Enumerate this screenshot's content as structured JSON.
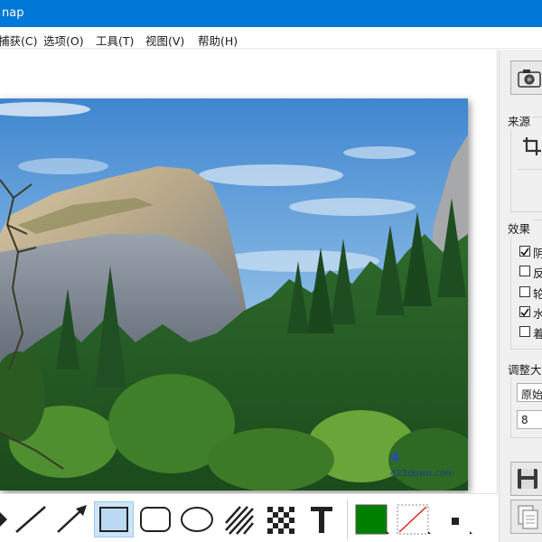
{
  "window": {
    "title": "nap"
  },
  "menu": [
    {
      "label": "捕获(C)"
    },
    {
      "label": "选项(O)"
    },
    {
      "label": "工具(T)"
    },
    {
      "label": "视图(V)"
    },
    {
      "label": "帮助(H)"
    }
  ],
  "canvas": {
    "watermark_brand": "4",
    "watermark_url": "423down.com"
  },
  "toolbar": {
    "tools": [
      {
        "icon": "arrow-head-icon"
      },
      {
        "icon": "line-icon"
      },
      {
        "icon": "arrow-icon"
      },
      {
        "icon": "rectangle-icon",
        "active": true
      },
      {
        "icon": "rounded-rectangle-icon"
      },
      {
        "icon": "ellipse-icon"
      },
      {
        "icon": "hatch-fill-icon"
      },
      {
        "icon": "pixelate-icon"
      },
      {
        "icon": "text-icon"
      },
      {
        "icon": "fill-color-swatch",
        "color": "#008000"
      },
      {
        "icon": "no-fill-swatch"
      },
      {
        "icon": "line-width-icon"
      }
    ],
    "fill_color": "#008000"
  },
  "sidebar": {
    "capture_icon": "camera-icon",
    "source_label": "来源",
    "crop_icon": "crop-icon",
    "effects_label": "效果",
    "effects": [
      {
        "label": "阴",
        "checked": true
      },
      {
        "label": "反",
        "checked": false
      },
      {
        "label": "轮",
        "checked": false
      },
      {
        "label": "水",
        "checked": true
      },
      {
        "label": "着",
        "checked": false
      }
    ],
    "resize_label": "调整大",
    "resize_mode": "原始",
    "resize_value": "8",
    "save_icon": "save-icon",
    "copy_icon": "copy-icon"
  }
}
